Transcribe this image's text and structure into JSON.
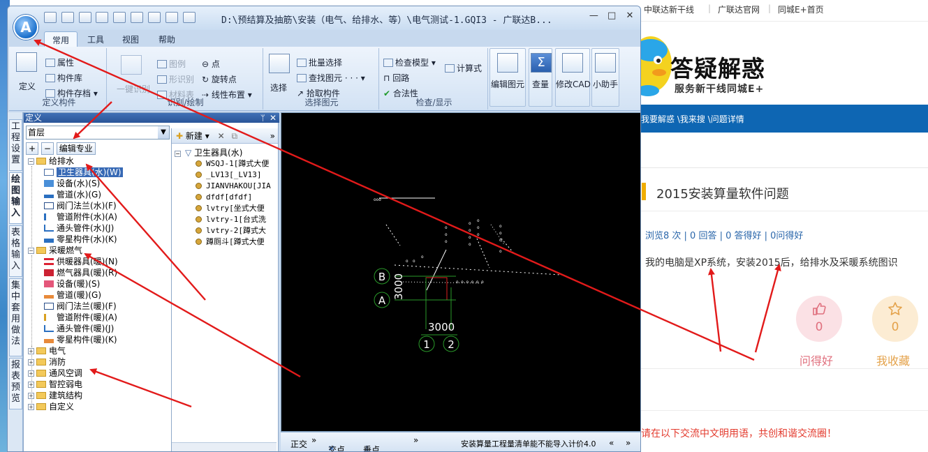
{
  "web": {
    "topnav": [
      "中联达新干线",
      "广联达官网",
      "同城E+首页"
    ],
    "brand_title": "答疑解惑",
    "brand_subtitle": "服务新干线同城E+",
    "breadcrumb": "我要解惑 \\我来搜 \\问题详情",
    "question_title": "2015安装算量软件问题",
    "stats": "浏览8 次 | 0 回答 | 0 答得好 | 0问得好",
    "question_body": "我的电脑是XP系统，安装2015后，给排水及采暖系统图识",
    "like_count": "0",
    "like_label": "问得好",
    "fav_count": "0",
    "fav_label": "我收藏",
    "footer_note": "请在以下交流中文明用语，共创和谐交流圈！",
    "colors": {
      "nav_blue": "#0e66b3",
      "accent_orange": "#f0ad00",
      "note_red": "#e33b2e"
    }
  },
  "app": {
    "orb_letter": "A",
    "title": "D:\\预结算及抽筋\\安装（电气、给排水、等）\\电气测试-1.GQI3 - 广联达B...",
    "window_buttons": [
      "—",
      "□",
      "✕"
    ],
    "tabs": [
      "常用",
      "工具",
      "视图",
      "帮助"
    ],
    "ribbon": {
      "define_group": {
        "label": "定义构件",
        "define_btn": "定义",
        "properties": "属性",
        "component_lib": "构件库",
        "component_save": "构件存档"
      },
      "recognize_group": {
        "label": "识别/绘制",
        "one_key": "一键识别",
        "legend": "图例",
        "shape": "形识别",
        "material_table": "材料表",
        "point": "点",
        "rotate_point": "旋转点",
        "linear_layout": "线性布置"
      },
      "select_group": {
        "label": "选择图元",
        "select": "选择",
        "batch_select": "批量选择",
        "find_element": "查找图元",
        "pick_component": "拾取构件"
      },
      "check_group": {
        "label": "检查/显示",
        "check_model": "检查模型",
        "loop": "回路",
        "legality": "合法性",
        "formula": "计算式"
      },
      "big_buttons": [
        "编辑图元",
        "查量",
        "修改CAD",
        "小助手"
      ]
    },
    "vertical_tabs": [
      "工程设置",
      "绘图输入",
      "表格输入",
      "集中套用做法",
      "报表预览"
    ],
    "def_panel": {
      "title": "定义",
      "pin": "ᛘ",
      "close": "✕",
      "floor": "首层",
      "edit_specialty": "编辑专业",
      "tree": [
        {
          "label": "给排水",
          "level": 0,
          "expanded": true
        },
        {
          "label": "卫生器具(水)(W)",
          "level": 1,
          "selected": true
        },
        {
          "label": "设备(水)(S)",
          "level": 1
        },
        {
          "label": "管道(水)(G)",
          "level": 1
        },
        {
          "label": "阀门法兰(水)(F)",
          "level": 1
        },
        {
          "label": "管道附件(水)(A)",
          "level": 1
        },
        {
          "label": "通头管件(水)(J)",
          "level": 1
        },
        {
          "label": "零星构件(水)(K)",
          "level": 1
        },
        {
          "label": "采暖燃气",
          "level": 0,
          "expanded": true
        },
        {
          "label": "供暖器具(暖)(N)",
          "level": 1
        },
        {
          "label": "燃气器具(暖)(R)",
          "level": 1
        },
        {
          "label": "设备(暖)(S)",
          "level": 1
        },
        {
          "label": "管道(暖)(G)",
          "level": 1
        },
        {
          "label": "阀门法兰(暖)(F)",
          "level": 1
        },
        {
          "label": "管道附件(暖)(A)",
          "level": 1
        },
        {
          "label": "通头管件(暖)(J)",
          "level": 1
        },
        {
          "label": "零星构件(暖)(K)",
          "level": 1
        },
        {
          "label": "电气",
          "level": 0
        },
        {
          "label": "消防",
          "level": 0
        },
        {
          "label": "通风空调",
          "level": 0
        },
        {
          "label": "智控弱电",
          "level": 0
        },
        {
          "label": "建筑结构",
          "level": 0
        },
        {
          "label": "自定义",
          "level": 0
        }
      ]
    },
    "sub_panel": {
      "new_label": "新建",
      "root": "卫生器具(水)",
      "items": [
        "WSQJ-1[蹲式大便",
        "_LV13[_LV13]",
        "JIANVHAKOU[JIA",
        "dfdf[dfdf]",
        "lvtry[坐式大便",
        "lvtry-1[台式洗",
        "lvtry-2[蹲式大",
        "蹲厕斗[蹲式大便"
      ]
    },
    "cad": {
      "grid_b": "B",
      "grid_a": "A",
      "grid_1": "1",
      "grid_2": "2",
      "dim_vertical": "3000",
      "dim_horizontal": "3000"
    },
    "statusbar": {
      "ortho": "正交",
      "intersection": "交点",
      "perpendicular": "垂点",
      "message": "安装算量工程量清单能不能导入计价4.0"
    }
  }
}
